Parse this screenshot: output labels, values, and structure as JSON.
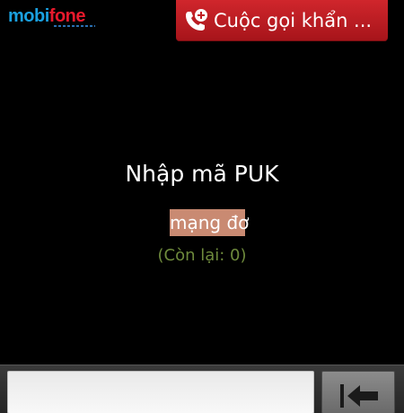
{
  "status_bar": {
    "carrier": {
      "part1": "mobi",
      "part2": "fone"
    }
  },
  "emergency": {
    "label": "Cuộc gọi khẩn ...",
    "icon": "phone-plus-icon",
    "color": "#c21e24"
  },
  "prompt": {
    "title": "Nhập mã PUK",
    "entry_highlight": "mạng đơ",
    "attempts": "(Còn lại: 0)"
  },
  "input": {
    "value": ""
  },
  "delete": {
    "icon": "backspace-icon"
  },
  "colors": {
    "background": "#000000",
    "highlight": "#c98a72",
    "attempts_text": "#6e8a3c",
    "mobi_blue": "#1aa0e0",
    "fone_red": "#e8192c"
  }
}
